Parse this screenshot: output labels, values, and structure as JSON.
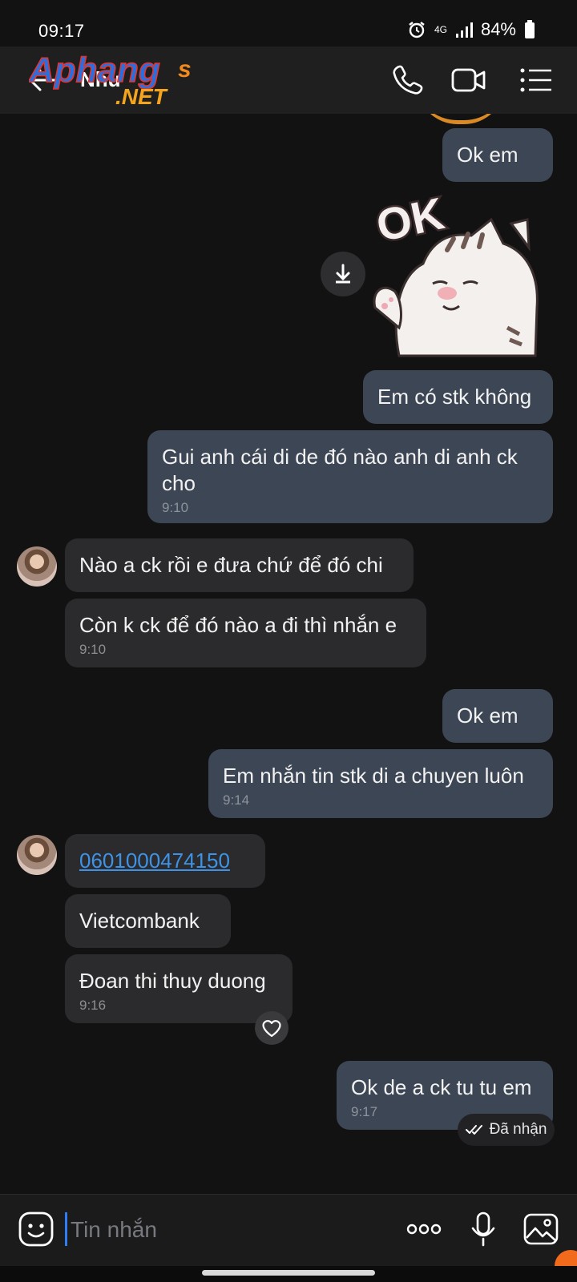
{
  "status_bar": {
    "time": "09:17",
    "network": "4G",
    "battery": "84%"
  },
  "header": {
    "contact_name": "Như",
    "watermark_text": "Aphangs .NET"
  },
  "messages": [
    {
      "text": "Ok em",
      "time": ""
    },
    {
      "text": "Em có stk không",
      "time": ""
    },
    {
      "text": "Gui anh cái di de đó nào anh di anh ck cho",
      "time": "9:10"
    },
    {
      "text": "Nào a ck rồi e đưa chứ để đó chi",
      "time": ""
    },
    {
      "text": "Còn k ck để đó nào a đi thì nhắn e",
      "time": "9:10"
    },
    {
      "text": "Ok em",
      "time": ""
    },
    {
      "text": "Em nhắn tin stk di a chuyen luôn",
      "time": "9:14"
    },
    {
      "text": "0601000474150",
      "time": ""
    },
    {
      "text": "Vietcombank",
      "time": ""
    },
    {
      "text": "Đoan thi thuy duong",
      "time": "9:16"
    },
    {
      "text": "Ok de a ck tu tu em",
      "time": "9:17"
    }
  ],
  "receipt": {
    "label": "Đã nhận"
  },
  "composer": {
    "placeholder": "Tin nhắn"
  },
  "colors": {
    "outgoing_bubble": "#3d4654",
    "incoming_bubble": "#2b2b2d",
    "link": "#3e93e6",
    "background": "#121213"
  }
}
